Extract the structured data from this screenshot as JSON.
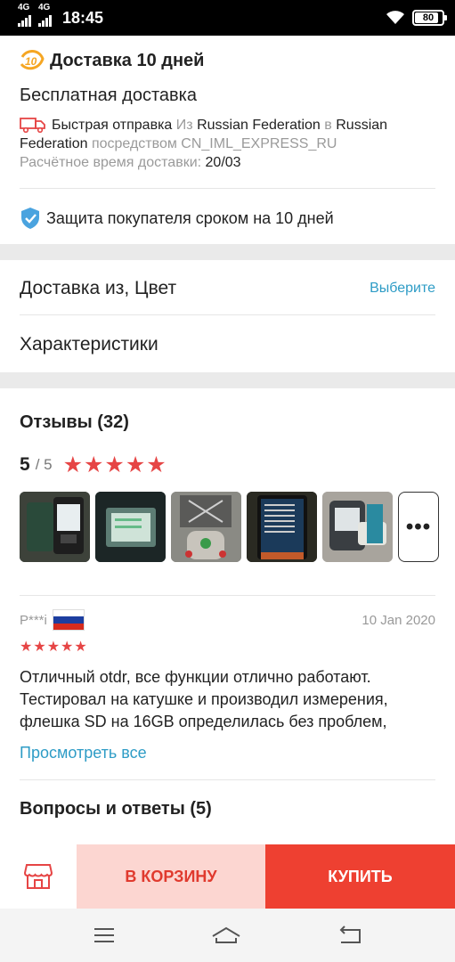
{
  "status_bar": {
    "signal1": "4G",
    "signal2": "4G",
    "time": "18:45",
    "battery": "80"
  },
  "delivery": {
    "title": "Доставка 10 дней",
    "free_title": "Бесплатная доставка",
    "fast_label": "Быстрая отправка",
    "from_word": "Из",
    "from_country": "Russian Federation",
    "to_word": "в",
    "to_country": "Russian Federation",
    "via_word": "посредством",
    "carrier": "CN_IML_EXPRESS_RU",
    "eta_label": "Расчётное время доставки:",
    "eta_value": "20/03"
  },
  "protection": {
    "text": "Защита покупателя сроком на 10 дней"
  },
  "options": {
    "ship_color_label": "Доставка из, Цвет",
    "choose_label": "Выберите",
    "specs_label": "Характеристики"
  },
  "reviews": {
    "title": "Отзывы (32)",
    "score": "5",
    "max": "/ 5",
    "stars": "★★★★★",
    "more_label": "•••",
    "item": {
      "author": "P***i",
      "date": "10 Jan 2020",
      "stars": "★★★★★",
      "text": "Отличный otdr, все функции отлично работают. Тестировал на катушке и производил измерения, флешка SD на 16GB определилась без проблем,"
    },
    "view_all": "Просмотреть все"
  },
  "qa": {
    "title": "Вопросы и ответы (5)"
  },
  "actions": {
    "cart": "В КОРЗИНУ",
    "buy": "КУПИТЬ"
  },
  "colors": {
    "accent_red": "#ee4031",
    "link_blue": "#2e9cc6",
    "star_red": "#e64545"
  }
}
